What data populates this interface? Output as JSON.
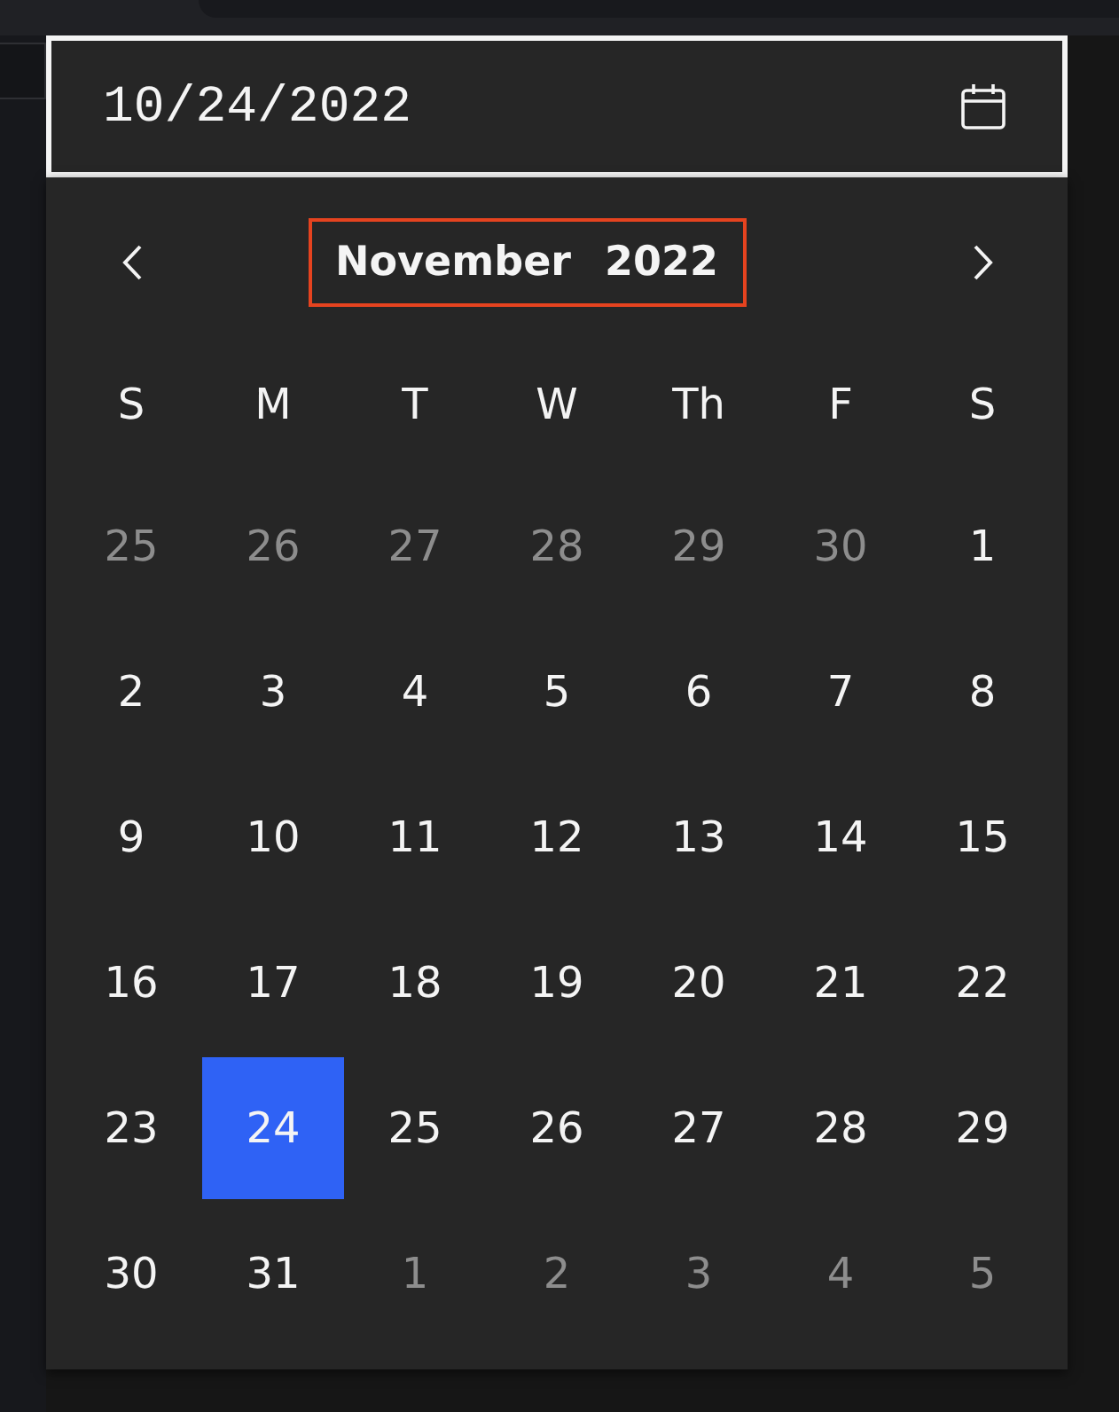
{
  "date_field": {
    "value": "10/24/2022",
    "focused": true
  },
  "calendar": {
    "month": "November",
    "year": "2022",
    "header_highlighted": true,
    "weekdays": [
      "S",
      "M",
      "T",
      "W",
      "Th",
      "F",
      "S"
    ],
    "weeks": [
      [
        {
          "day": "25",
          "outside": true,
          "selected": false
        },
        {
          "day": "26",
          "outside": true,
          "selected": false
        },
        {
          "day": "27",
          "outside": true,
          "selected": false
        },
        {
          "day": "28",
          "outside": true,
          "selected": false
        },
        {
          "day": "29",
          "outside": true,
          "selected": false
        },
        {
          "day": "30",
          "outside": true,
          "selected": false
        },
        {
          "day": "1",
          "outside": false,
          "selected": false
        }
      ],
      [
        {
          "day": "2",
          "outside": false,
          "selected": false
        },
        {
          "day": "3",
          "outside": false,
          "selected": false
        },
        {
          "day": "4",
          "outside": false,
          "selected": false
        },
        {
          "day": "5",
          "outside": false,
          "selected": false
        },
        {
          "day": "6",
          "outside": false,
          "selected": false
        },
        {
          "day": "7",
          "outside": false,
          "selected": false
        },
        {
          "day": "8",
          "outside": false,
          "selected": false
        }
      ],
      [
        {
          "day": "9",
          "outside": false,
          "selected": false
        },
        {
          "day": "10",
          "outside": false,
          "selected": false
        },
        {
          "day": "11",
          "outside": false,
          "selected": false
        },
        {
          "day": "12",
          "outside": false,
          "selected": false
        },
        {
          "day": "13",
          "outside": false,
          "selected": false
        },
        {
          "day": "14",
          "outside": false,
          "selected": false
        },
        {
          "day": "15",
          "outside": false,
          "selected": false
        }
      ],
      [
        {
          "day": "16",
          "outside": false,
          "selected": false
        },
        {
          "day": "17",
          "outside": false,
          "selected": false
        },
        {
          "day": "18",
          "outside": false,
          "selected": false
        },
        {
          "day": "19",
          "outside": false,
          "selected": false
        },
        {
          "day": "20",
          "outside": false,
          "selected": false
        },
        {
          "day": "21",
          "outside": false,
          "selected": false
        },
        {
          "day": "22",
          "outside": false,
          "selected": false
        }
      ],
      [
        {
          "day": "23",
          "outside": false,
          "selected": false
        },
        {
          "day": "24",
          "outside": false,
          "selected": true
        },
        {
          "day": "25",
          "outside": false,
          "selected": false
        },
        {
          "day": "26",
          "outside": false,
          "selected": false
        },
        {
          "day": "27",
          "outside": false,
          "selected": false
        },
        {
          "day": "28",
          "outside": false,
          "selected": false
        },
        {
          "day": "29",
          "outside": false,
          "selected": false
        }
      ],
      [
        {
          "day": "30",
          "outside": false,
          "selected": false
        },
        {
          "day": "31",
          "outside": false,
          "selected": false
        },
        {
          "day": "1",
          "outside": true,
          "selected": false
        },
        {
          "day": "2",
          "outside": true,
          "selected": false
        },
        {
          "day": "3",
          "outside": true,
          "selected": false
        },
        {
          "day": "4",
          "outside": true,
          "selected": false
        },
        {
          "day": "5",
          "outside": true,
          "selected": false
        }
      ]
    ]
  }
}
